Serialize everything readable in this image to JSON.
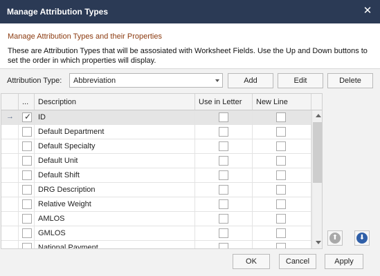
{
  "window": {
    "title": "Manage Attribution Types",
    "close_glyph": "✕"
  },
  "header": {
    "heading": "Manage Attribution Types and their Properties",
    "description": "These are Attribution Types that will be assosiated with Worksheet Fields. Use the Up and Down buttons to set the order in which properties will display."
  },
  "attribution": {
    "label": "Attribution Type:",
    "selected": "Abbreviation"
  },
  "toolbar": {
    "add_label": "Add",
    "edit_label": "Edit",
    "delete_label": "Delete"
  },
  "grid": {
    "columns": {
      "checkbox": "...",
      "description": "Description",
      "use_in_letter": "Use in Letter",
      "new_line": "New Line"
    },
    "current_row_glyph": "→",
    "check_glyph": "✓",
    "rows": [
      {
        "description": "ID",
        "checked": true,
        "use_in_letter": false,
        "new_line": false,
        "current": true
      },
      {
        "description": "Default Department",
        "checked": false,
        "use_in_letter": false,
        "new_line": false
      },
      {
        "description": "Default Specialty",
        "checked": false,
        "use_in_letter": false,
        "new_line": false
      },
      {
        "description": "Default Unit",
        "checked": false,
        "use_in_letter": false,
        "new_line": false
      },
      {
        "description": "Default Shift",
        "checked": false,
        "use_in_letter": false,
        "new_line": false
      },
      {
        "description": "DRG Description",
        "checked": false,
        "use_in_letter": false,
        "new_line": false
      },
      {
        "description": "Relative Weight",
        "checked": false,
        "use_in_letter": false,
        "new_line": false
      },
      {
        "description": "AMLOS",
        "checked": false,
        "use_in_letter": false,
        "new_line": false
      },
      {
        "description": "GMLOS",
        "checked": false,
        "use_in_letter": false,
        "new_line": false
      },
      {
        "description": "National Payment",
        "checked": false,
        "use_in_letter": false,
        "new_line": false
      }
    ]
  },
  "order_buttons": {
    "up_icon": "arrow-up-icon",
    "down_icon": "arrow-down-icon",
    "up_glyph": "⬆",
    "down_glyph": "⬇"
  },
  "footer": {
    "ok_label": "OK",
    "cancel_label": "Cancel",
    "apply_label": "Apply"
  },
  "colors": {
    "titlebar": "#2b3a55",
    "heading": "#8b3a0f",
    "move_down_accent": "#2f5fa8"
  }
}
